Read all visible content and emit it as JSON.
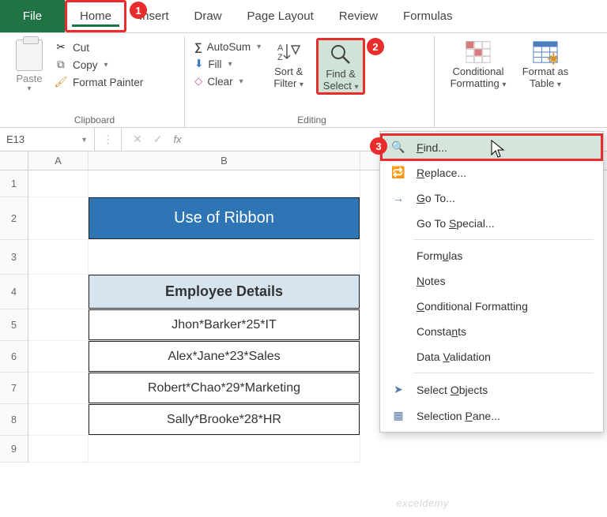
{
  "tabs": {
    "file": "File",
    "home": "Home",
    "insert": "Insert",
    "draw": "Draw",
    "page_layout": "Page Layout",
    "review": "Review",
    "formulas": "Formulas"
  },
  "ribbon": {
    "clipboard": {
      "paste": "Paste",
      "cut": "Cut",
      "copy": "Copy",
      "drop": "▾",
      "painter": "Format Painter",
      "group_label": "Clipboard"
    },
    "editing": {
      "autosum": "AutoSum",
      "fill": "Fill",
      "clear": "Clear",
      "sort_filter_l1": "Sort &",
      "sort_filter_l2": "Filter",
      "find_select_l1": "Find &",
      "find_select_l2": "Select",
      "group_label": "Editing"
    },
    "cond_l1": "Conditional",
    "cond_l2": "Formatting",
    "table_l1": "Format as",
    "table_l2": "Table"
  },
  "namebox": {
    "ref": "E13"
  },
  "columns": {
    "a": "A",
    "b": "B"
  },
  "rows": [
    "1",
    "2",
    "3",
    "4",
    "5",
    "6",
    "7",
    "8",
    "9"
  ],
  "sheet": {
    "title": "Use of Ribbon",
    "header": "Employee Details",
    "data": [
      "Jhon*Barker*25*IT",
      "Alex*Jane*23*Sales",
      "Robert*Chao*29*Marketing",
      "Sally*Brooke*28*HR"
    ]
  },
  "menu": {
    "find": "Find...",
    "replace": "Replace...",
    "goto": "Go To...",
    "goto_special": "Go To Special...",
    "formulas": "Formulas",
    "notes": "Notes",
    "cond_fmt": "Conditional Formatting",
    "constants": "Constants",
    "data_val": "Data Validation",
    "sel_obj": "Select Objects",
    "sel_pane": "Selection Pane..."
  },
  "badges": {
    "b1": "1",
    "b2": "2",
    "b3": "3"
  },
  "watermark": "exceldemy"
}
